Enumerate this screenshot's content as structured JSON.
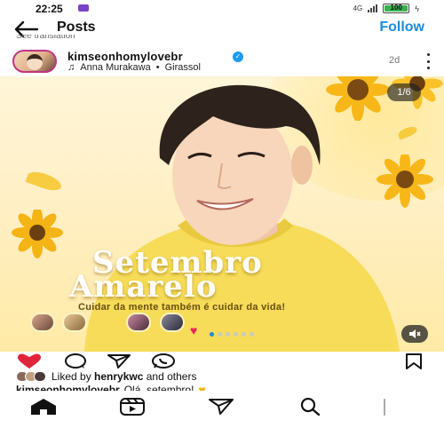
{
  "status_bar": {
    "time": "22:25",
    "network": "4G",
    "battery": "100",
    "charging_icon": "bolt-icon"
  },
  "top_bar": {
    "back_icon": "arrow-left-icon",
    "title": "Posts",
    "follow_label": "Follow",
    "see_translation": "See translation"
  },
  "post": {
    "username": "kimseonhomylovebr",
    "verified_icon": "verified-badge-icon",
    "music_icon": "music-note-icon",
    "music_artist": "Anna Murakawa",
    "music_separator": "•",
    "music_title": "Girassol",
    "age": "2d",
    "more_icon": "more-vertical-icon"
  },
  "media": {
    "counter": "1/6",
    "headline_line1": "Setembro",
    "headline_line2": "Amarelo",
    "subtitle": "Cuidar da mente também é cuidar da vida!",
    "mute_icon": "speaker-muted-icon",
    "accent_color": "#f6c52c"
  },
  "carousel": {
    "total": 6,
    "active": 1
  },
  "actions": {
    "like_icon": "heart-filled-icon",
    "like_color": "#e0243b",
    "comment_icon": "comment-icon",
    "share_icon": "send-icon",
    "whatsapp_icon": "whatsapp-icon",
    "save_icon": "bookmark-icon"
  },
  "likes": {
    "prefix": "Liked by",
    "user": "henrykwc",
    "suffix": "and others"
  },
  "caption": {
    "username": "kimseonhomylovebr",
    "text": "Olá, setembro!",
    "emoji": "yellow-heart-icon"
  },
  "bottom_nav": {
    "home_icon": "home-icon",
    "reels_icon": "reels-icon",
    "messages_icon": "send-icon",
    "search_icon": "search-icon",
    "profile_icon": "profile-avatar-icon"
  }
}
